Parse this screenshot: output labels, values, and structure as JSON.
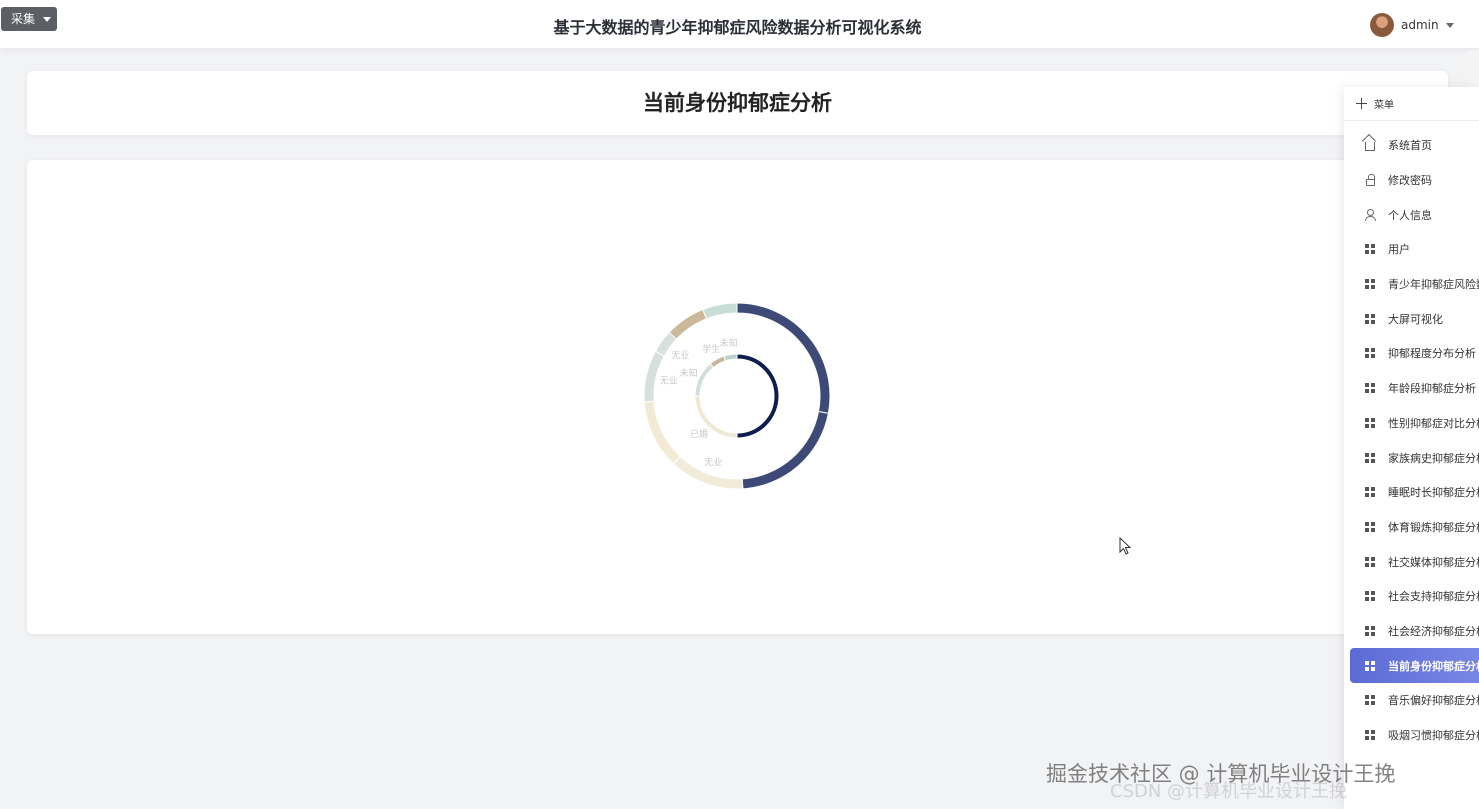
{
  "header": {
    "collect_button": "采集",
    "system_title": "基于大数据的青少年抑郁症风险数据分析可视化系统",
    "username": "admin"
  },
  "page": {
    "title": "当前身份抑郁症分析"
  },
  "menu": {
    "title": "菜单",
    "items": [
      {
        "label": "系统首页",
        "icon": "home-icon"
      },
      {
        "label": "修改密码",
        "icon": "lock-icon"
      },
      {
        "label": "个人信息",
        "icon": "user-icon"
      },
      {
        "label": "用户",
        "icon": "grid-icon"
      },
      {
        "label": "青少年抑郁症风险数",
        "icon": "grid-icon"
      },
      {
        "label": "大屏可视化",
        "icon": "grid-icon"
      },
      {
        "label": "抑郁程度分布分析",
        "icon": "grid-icon"
      },
      {
        "label": "年龄段抑郁症分析",
        "icon": "grid-icon"
      },
      {
        "label": "性别抑郁症对比分析",
        "icon": "grid-icon"
      },
      {
        "label": "家族病史抑郁症分析",
        "icon": "grid-icon"
      },
      {
        "label": "睡眠时长抑郁症分析",
        "icon": "grid-icon"
      },
      {
        "label": "体育锻炼抑郁症分析",
        "icon": "grid-icon"
      },
      {
        "label": "社交媒体抑郁症分析",
        "icon": "grid-icon"
      },
      {
        "label": "社会支持抑郁症分析",
        "icon": "grid-icon"
      },
      {
        "label": "社会经济抑郁症分析",
        "icon": "grid-icon"
      },
      {
        "label": "当前身份抑郁症分析",
        "icon": "grid-icon",
        "active": true
      },
      {
        "label": "音乐偏好抑郁症分析",
        "icon": "grid-icon"
      },
      {
        "label": "吸烟习惯抑郁症分析",
        "icon": "grid-icon"
      }
    ]
  },
  "chart_data": {
    "type": "pie",
    "rings": [
      {
        "ring": "inner",
        "series": [
          {
            "name": "",
            "value": 50,
            "color": "#0f1d4f"
          },
          {
            "name": "已婚",
            "value": 25,
            "color": "#efe8d4"
          },
          {
            "name": "未知",
            "value": 14,
            "color": "#d3dedb"
          },
          {
            "name": "学生",
            "value": 6,
            "color": "#c9b79a"
          },
          {
            "name": "未知",
            "value": 5,
            "color": "#b9d2cc"
          }
        ]
      },
      {
        "ring": "outer",
        "series": [
          {
            "name": "",
            "value": 28,
            "color": "#3d4a77"
          },
          {
            "name": "",
            "value": 21,
            "color": "#3d4a77"
          },
          {
            "name": "无业",
            "value": 13,
            "color": "#f2ebd9"
          },
          {
            "name": "",
            "value": 12,
            "color": "#f3ead6"
          },
          {
            "name": "无业",
            "value": 9,
            "color": "#d6e0dd"
          },
          {
            "name": "无业",
            "value": 4,
            "color": "#d6e0dd"
          },
          {
            "name": "",
            "value": 7,
            "color": "#ccb99b"
          },
          {
            "name": "",
            "value": 6,
            "color": "#c8ddd5"
          }
        ]
      }
    ]
  },
  "watermark": "掘金技术社区 @ 计算机毕业设计王挽",
  "watermark_faint": "CSDN @计算机毕业设计王挽"
}
